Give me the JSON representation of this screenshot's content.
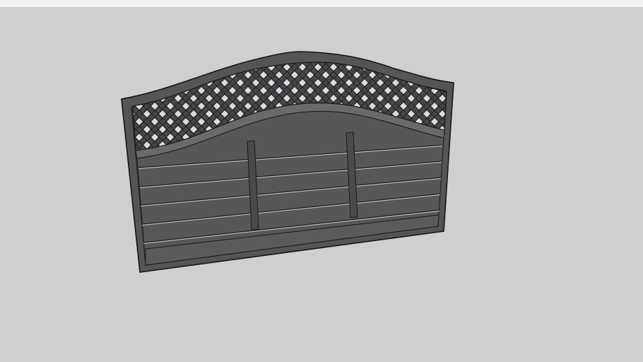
{
  "scene": {
    "background_color": "#cfcfcf",
    "toolbar_color": "#f1f1f1",
    "model_colors": {
      "wood": "#595959",
      "wood_dark": "#4a4a4a",
      "edge": "#1a1a1a",
      "highlight": "#bfc3c8",
      "lattice_gap": "#d6dde4"
    }
  }
}
